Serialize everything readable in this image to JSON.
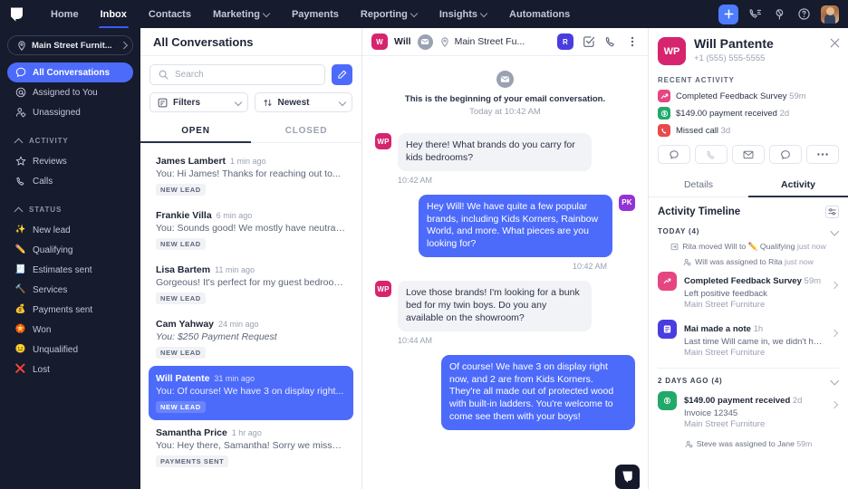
{
  "topnav": {
    "logo_name": "app-logo",
    "items": [
      {
        "label": "Home",
        "caret": false,
        "active": false
      },
      {
        "label": "Inbox",
        "caret": false,
        "active": true
      },
      {
        "label": "Contacts",
        "caret": false,
        "active": false
      },
      {
        "label": "Marketing",
        "caret": true,
        "active": false
      },
      {
        "label": "Payments",
        "caret": false,
        "active": false
      },
      {
        "label": "Reporting",
        "caret": true,
        "active": false
      },
      {
        "label": "Insights",
        "caret": true,
        "active": false
      },
      {
        "label": "Automations",
        "caret": false,
        "active": false
      }
    ],
    "add_button_label": "+",
    "icons": [
      "phone-incoming-icon",
      "megaphone-icon",
      "help-circle-icon"
    ],
    "avatar_name": "user-avatar",
    "bg_color": "#161b2e",
    "accent_color": "#3b5bfd"
  },
  "sidebar": {
    "location_switcher": {
      "label": "Main Street Furnit...",
      "icon": "location-pin-icon"
    },
    "primary_items": [
      {
        "label": "All Conversations",
        "icon": "chat-bubble-icon",
        "active": true
      },
      {
        "label": "Assigned to You",
        "icon": "at-sign-icon",
        "active": false
      },
      {
        "label": "Unassigned",
        "icon": "user-gear-icon",
        "active": false
      }
    ],
    "groups": [
      {
        "label": "ACTIVITY",
        "items": [
          {
            "label": "Reviews",
            "icon": "star-icon",
            "emoji": ""
          },
          {
            "label": "Calls",
            "icon": "phone-icon",
            "emoji": ""
          }
        ]
      },
      {
        "label": "STATUS",
        "items": [
          {
            "label": "New lead",
            "icon": "sparkles-emoji",
            "emoji": "✨"
          },
          {
            "label": "Qualifying",
            "icon": "pencil-emoji",
            "emoji": "✏️"
          },
          {
            "label": "Estimates sent",
            "icon": "receipt-emoji",
            "emoji": "🧾"
          },
          {
            "label": "Services",
            "icon": "tools-emoji",
            "emoji": "🔨"
          },
          {
            "label": "Payments sent",
            "icon": "money-bag-emoji",
            "emoji": "💰"
          },
          {
            "label": "Won",
            "icon": "trophy-emoji",
            "emoji": "🏵️"
          },
          {
            "label": "Unqualified",
            "icon": "neutral-face-emoji",
            "emoji": "😐"
          },
          {
            "label": "Lost",
            "icon": "cross-mark-emoji",
            "emoji": "❌"
          }
        ]
      }
    ]
  },
  "conversation_list": {
    "title": "All Conversations",
    "search": {
      "placeholder": "Search",
      "value": ""
    },
    "compose_label": "compose-icon",
    "filters_label": "Filters",
    "sort_label": "Newest",
    "tabs": [
      {
        "label": "OPEN",
        "active": true
      },
      {
        "label": "CLOSED",
        "active": false
      }
    ],
    "items": [
      {
        "name": "James Lambert",
        "time": "1 min ago",
        "preview": "You: Hi James! Thanks for reaching out to...",
        "badge": "NEW LEAD",
        "selected": false,
        "italic": false
      },
      {
        "name": "Frankie Villa",
        "time": "6 min ago",
        "preview": "You: Sounds good! We mostly have neutrals...",
        "badge": "NEW LEAD",
        "selected": false,
        "italic": false
      },
      {
        "name": "Lisa Bartem",
        "time": "11 min ago",
        "preview": "Gorgeous! It's perfect for my guest bedroom...",
        "badge": "NEW LEAD",
        "selected": false,
        "italic": false
      },
      {
        "name": "Cam Yahway",
        "time": "24 min ago",
        "preview": "You: $250 Payment Request",
        "badge": "NEW LEAD",
        "selected": false,
        "italic": true
      },
      {
        "name": "Will Patente",
        "time": "31 min ago",
        "preview": "You: Of course! We have 3 on display right...",
        "badge": "NEW LEAD",
        "selected": true,
        "italic": false
      },
      {
        "name": "Samantha Price",
        "time": "1 hr ago",
        "preview": "You: Hey there, Samantha! Sorry we missed...",
        "badge": "PAYMENTS SENT",
        "selected": false,
        "italic": false
      }
    ]
  },
  "thread": {
    "header": {
      "avatar_initial": "W",
      "avatar_color": "#d6246e",
      "contact_name": "Will",
      "channel_icon": "email-icon",
      "location_label": "Main Street Fu...",
      "assignee_initial": "R",
      "assignee_color": "#4a3de0",
      "icons": [
        "check-square-icon",
        "phone-icon",
        "more-vertical-icon"
      ]
    },
    "start_notice": {
      "icon": "email-icon",
      "line1": "This is the beginning of your email conversation.",
      "line2": "Today at 10:42 AM"
    },
    "messages": [
      {
        "direction": "in",
        "avatar_initial": "WP",
        "avatar_color": "#d6246e",
        "text": "Hey there! What brands do you carry for kids bedrooms?",
        "time": "10:42 AM"
      },
      {
        "direction": "out",
        "avatar_initial": "PK",
        "avatar_color": "#9333d6",
        "text": "Hey Will! We have quite a few popular brands, including Kids Korners, Rainbow World, and more. What pieces are you looking for?",
        "time": "10:42 AM"
      },
      {
        "direction": "in",
        "avatar_initial": "WP",
        "avatar_color": "#d6246e",
        "text": "Love those brands! I'm looking for a bunk bed for my twin boys. Do you any available on the showroom?",
        "time": "10:44 AM"
      },
      {
        "direction": "out",
        "avatar_initial": "",
        "avatar_color": "#9333d6",
        "text": "Of course! We have 3 on display right now, and 2 are from Kids Korners. They're all made out of protected wood with built-in ladders. You're welcome to come see them with your boys!",
        "time": ""
      }
    ],
    "fab_label": "chat-widget-icon"
  },
  "right_panel": {
    "contact": {
      "avatar_initial": "WP",
      "avatar_color": "#d6246e",
      "name": "Will Pantente",
      "phone": "+1 (555) 555-5555",
      "close_label": "close-icon"
    },
    "recent_activity_title": "RECENT ACTIVITY",
    "recent_activity": [
      {
        "text": "Completed Feedback Survey",
        "time": "59m",
        "icon": "trending-up-icon",
        "color": "#e6467f"
      },
      {
        "text": "$149.00 payment received",
        "time": "2d",
        "icon": "dollar-circle-icon",
        "color": "#22a96a"
      },
      {
        "text": "Missed call",
        "time": "3d",
        "icon": "phone-missed-icon",
        "color": "#e84b4b"
      }
    ],
    "actions": [
      "sms-icon",
      "phone-icon",
      "email-icon",
      "chat-icon",
      "more-horizontal-icon"
    ],
    "tabs": [
      {
        "label": "Details",
        "active": false
      },
      {
        "label": "Activity",
        "active": true
      }
    ],
    "timeline": {
      "title": "Activity Timeline",
      "filter_label": "filter-sliders-icon",
      "groups": [
        {
          "label": "TODAY (4)",
          "entries": [
            {
              "kind": "mini",
              "icon": "board-move-icon",
              "text": "Rita moved Will to ✏️ Qualifying",
              "time": "just now"
            },
            {
              "kind": "mini",
              "icon": "user-assign-icon",
              "text": "Will was assigned to Rita",
              "time": "just now"
            },
            {
              "kind": "card",
              "icon": "trending-up-icon",
              "color": "#e6467f",
              "title": "Completed Feedback Survey",
              "time": "59m",
              "subtitle": "Left positive feedback",
              "meta": "Main Street Furniture"
            },
            {
              "kind": "card",
              "icon": "note-icon",
              "color": "#4a3de0",
              "title": "Mai made a note",
              "time": "1h",
              "subtitle": "Last time Will came in, we didn't have the...",
              "meta": "Main Street Furniture"
            }
          ]
        },
        {
          "label": "2 DAYS AGO (4)",
          "entries": [
            {
              "kind": "card",
              "icon": "dollar-circle-icon",
              "color": "#22a96a",
              "title": "$149.00 payment received",
              "time": "2d",
              "subtitle": "Invoice 12345",
              "meta": "Main Street Furniture"
            },
            {
              "kind": "mini",
              "icon": "user-assign-icon",
              "text": "Steve was assigned to Jane",
              "time": "59m"
            }
          ]
        }
      ]
    }
  }
}
